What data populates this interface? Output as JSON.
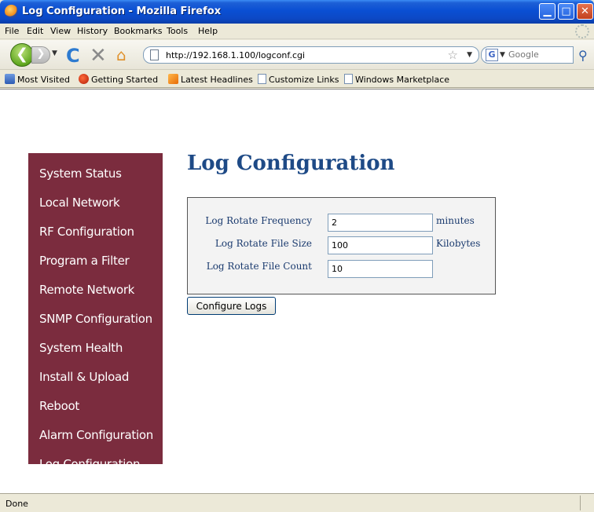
{
  "window": {
    "title": "Log Configuration - Mozilla Firefox",
    "minimize_glyph": "▁",
    "maximize_glyph": "□",
    "close_glyph": "✕"
  },
  "menubar": {
    "items": [
      {
        "key": "F",
        "rest": "ile"
      },
      {
        "key": "E",
        "rest": "dit"
      },
      {
        "key": "V",
        "rest": "iew"
      },
      {
        "key": "H",
        "rest": "istory",
        "key_after": "s",
        "pre": "Hi",
        "post": "tory"
      },
      {
        "key": "B",
        "rest": "ookmarks"
      },
      {
        "key": "T",
        "rest": "ools"
      },
      {
        "key": "H",
        "rest": "elp"
      }
    ],
    "labels": [
      "File",
      "Edit",
      "View",
      "History",
      "Bookmarks",
      "Tools",
      "Help"
    ]
  },
  "navbar": {
    "back_glyph": "❮",
    "forward_glyph": "❯",
    "dropdown_glyph": "▼",
    "reload_glyph": "C",
    "stop_glyph": "✕",
    "home_glyph": "⌂",
    "url": "http://192.168.1.100/logconf.cgi",
    "star_glyph": "☆",
    "search_engine_glyph": "G",
    "search_placeholder": "Google",
    "magnifier_glyph": "⚲"
  },
  "bookmarks": {
    "items": [
      "Most Visited",
      "Getting Started",
      "Latest Headlines",
      "Customize Links",
      "Windows Marketplace"
    ]
  },
  "sidebar": {
    "items": [
      "System Status",
      "Local Network",
      "RF Configuration",
      "Program a Filter",
      "Remote Network",
      "SNMP Configuration",
      "System Health",
      "Install & Upload",
      "Reboot",
      "Alarm Configuration",
      "Log Configuration"
    ]
  },
  "page": {
    "title": "Log Configuration"
  },
  "form": {
    "rotate_frequency": {
      "label": "Log Rotate Frequency",
      "value": "2",
      "unit": "minutes"
    },
    "rotate_file_size": {
      "label": "Log Rotate File Size",
      "value": "100",
      "unit": "Kilobytes"
    },
    "rotate_file_count": {
      "label": "Log Rotate File Count",
      "value": "10"
    },
    "submit_label": "Configure Logs"
  },
  "status": {
    "text": "Done"
  },
  "colors": {
    "sidebar_bg": "#7b2c3e",
    "title_color": "#1e4a86",
    "label_color": "#1a3a6e"
  }
}
